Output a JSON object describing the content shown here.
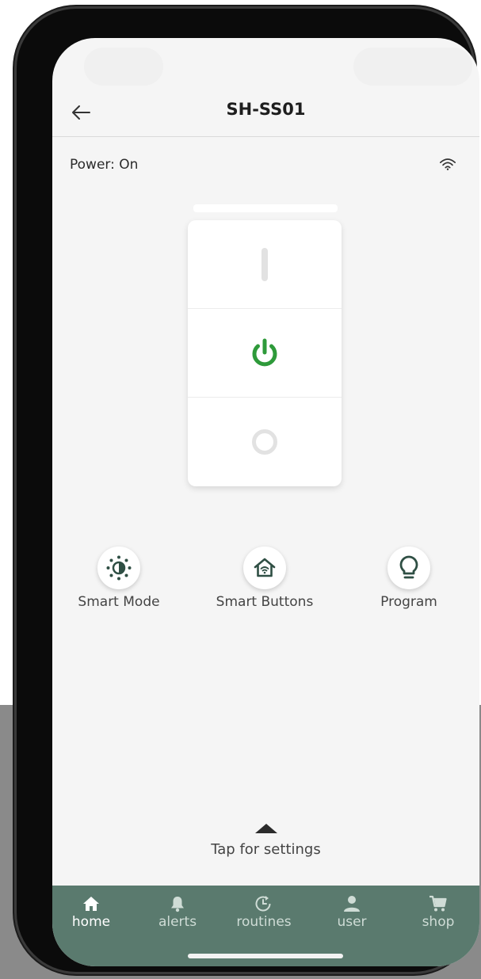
{
  "header": {
    "title": "SH-SS01",
    "back_icon": "back-arrow-icon"
  },
  "status": {
    "power_text": "Power: On",
    "wifi_icon": "wifi-icon"
  },
  "switch": {
    "positions": [
      "on-bar",
      "power",
      "off-circle"
    ],
    "active": "power",
    "accent": "#2e9a3a"
  },
  "actions": [
    {
      "label": "Smart Mode",
      "icon": "brightness-icon"
    },
    {
      "label": "Smart Buttons",
      "icon": "home-wifi-icon"
    },
    {
      "label": "Program",
      "icon": "lightbulb-icon"
    }
  ],
  "settings": {
    "label": "Tap for settings",
    "icon": "caret-up-icon"
  },
  "tabs": [
    {
      "label": "home",
      "icon": "home-icon",
      "active": true
    },
    {
      "label": "alerts",
      "icon": "bell-icon",
      "active": false
    },
    {
      "label": "routines",
      "icon": "clock-icon",
      "active": false
    },
    {
      "label": "user",
      "icon": "user-icon",
      "active": false
    },
    {
      "label": "shop",
      "icon": "cart-icon",
      "active": false
    }
  ],
  "colors": {
    "tabbar": "#5a7a6e",
    "icon_dark": "#2f4f44",
    "switch_on": "#2e9a3a"
  }
}
